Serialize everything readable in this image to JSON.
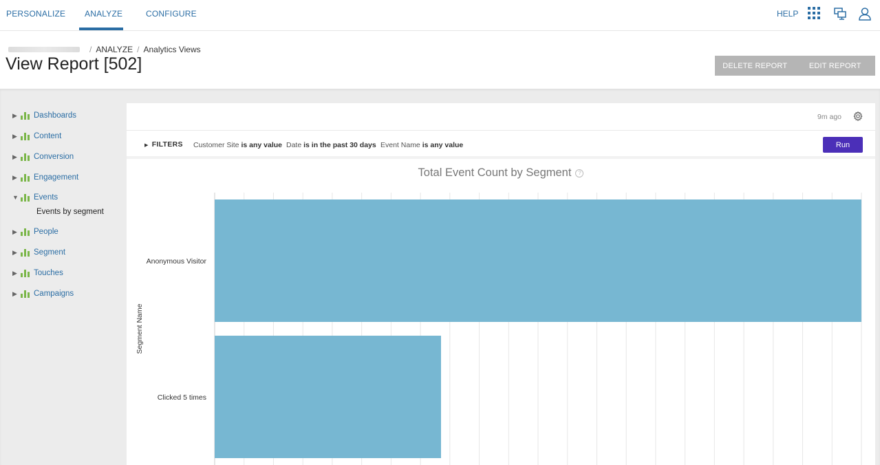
{
  "topnav": {
    "tabs": [
      {
        "label": "PERSONALIZE"
      },
      {
        "label": "ANALYZE"
      },
      {
        "label": "CONFIGURE"
      }
    ],
    "active_tab": "ANALYZE",
    "help_label": "HELP",
    "icons": [
      "apps-grid-icon",
      "monitor-icon",
      "user-icon"
    ]
  },
  "header": {
    "breadcrumb": {
      "section": "ANALYZE",
      "page": "Analytics Views"
    },
    "title": "View Report [502]",
    "delete_label": "DELETE REPORT",
    "edit_label": "EDIT REPORT"
  },
  "sidebar": {
    "items": [
      {
        "label": "Dashboards"
      },
      {
        "label": "Content"
      },
      {
        "label": "Conversion"
      },
      {
        "label": "Engagement"
      },
      {
        "label": "Events"
      },
      {
        "label": "People"
      },
      {
        "label": "Segment"
      },
      {
        "label": "Touches"
      },
      {
        "label": "Campaigns"
      }
    ],
    "expanded_item": "Events",
    "sub_item": "Events by segment"
  },
  "panel": {
    "timeago": "9m ago",
    "filters_label": "FILTERS",
    "filters": [
      {
        "field": "Customer Site",
        "condition": "is any value"
      },
      {
        "field": "Date",
        "condition": "is in the past 30 days"
      },
      {
        "field": "Event Name",
        "condition": "is any value"
      }
    ],
    "run_label": "Run",
    "help_mark": "?"
  },
  "colors": {
    "accent": "#2a6da4",
    "run_button": "#4b2fb8",
    "bar": "#77b7d2",
    "sidebar_icon": "#7ab648"
  },
  "chart_data": {
    "type": "bar",
    "orientation": "horizontal",
    "title": "Total Event Count by Segment",
    "ylabel": "Segment Name",
    "xlabel": "",
    "categories": [
      "Anonymous Visitor",
      "Clicked 5 times"
    ],
    "values": [
      100,
      35
    ],
    "value_note_hidden": true,
    "grid": true
  }
}
